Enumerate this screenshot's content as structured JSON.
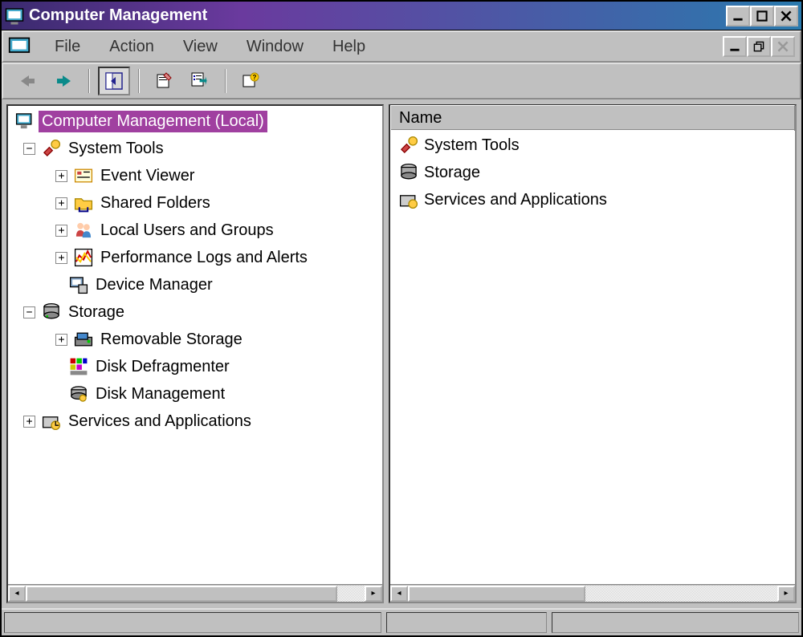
{
  "window": {
    "title": "Computer Management"
  },
  "menu": {
    "items": [
      "File",
      "Action",
      "View",
      "Window",
      "Help"
    ]
  },
  "toolbar": {
    "back": "back",
    "forward": "forward",
    "up_tree": "show-hide-tree",
    "properties": "properties",
    "export": "export-list",
    "help": "help"
  },
  "tree": {
    "root": {
      "label": "Computer Management (Local)",
      "selected": true
    },
    "nodes": [
      {
        "label": "System Tools",
        "expanded": true,
        "children": [
          {
            "label": "Event Viewer",
            "expandable": true
          },
          {
            "label": "Shared Folders",
            "expandable": true
          },
          {
            "label": "Local Users and Groups",
            "expandable": true
          },
          {
            "label": "Performance Logs and Alerts",
            "expandable": true
          },
          {
            "label": "Device Manager",
            "expandable": false
          }
        ]
      },
      {
        "label": "Storage",
        "expanded": true,
        "children": [
          {
            "label": "Removable Storage",
            "expandable": true
          },
          {
            "label": "Disk Defragmenter",
            "expandable": false
          },
          {
            "label": "Disk Management",
            "expandable": false
          }
        ]
      },
      {
        "label": "Services and Applications",
        "expanded": false,
        "children": []
      }
    ]
  },
  "list": {
    "header": "Name",
    "items": [
      {
        "label": "System Tools"
      },
      {
        "label": "Storage"
      },
      {
        "label": "Services and Applications"
      }
    ]
  }
}
